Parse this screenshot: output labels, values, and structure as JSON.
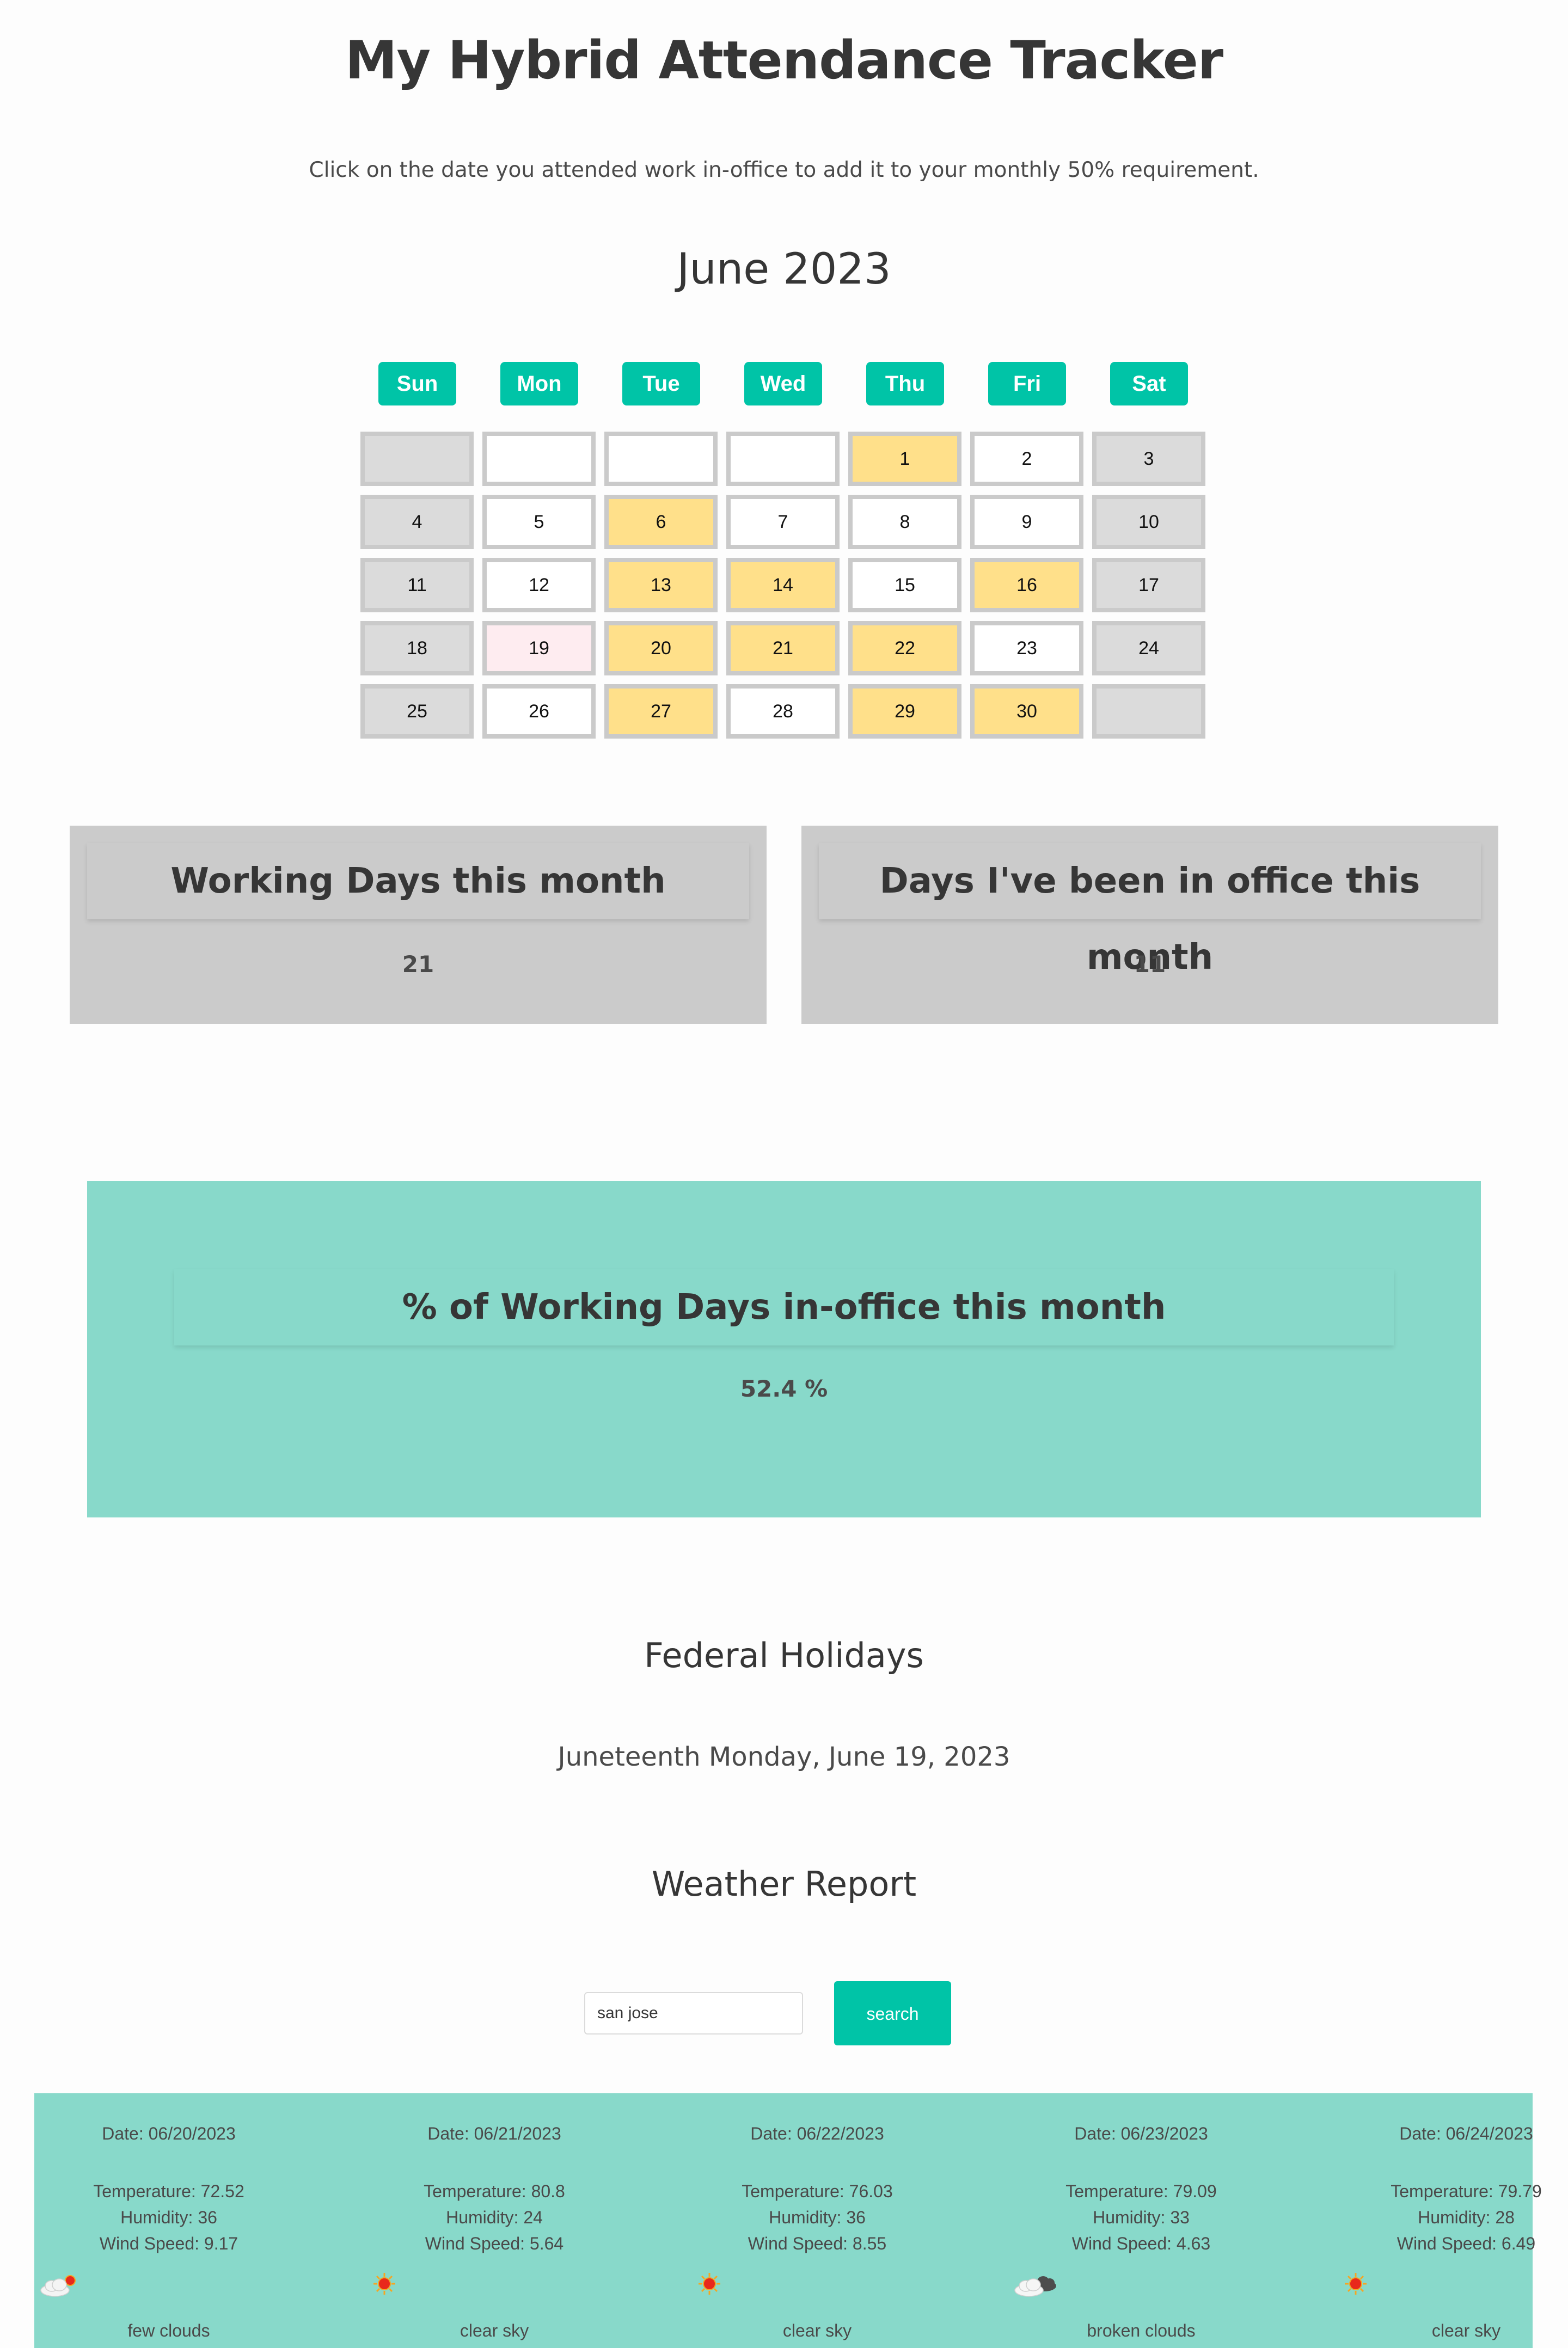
{
  "header": {
    "title": "My Hybrid Attendance Tracker",
    "subtitle": "Click on the date you attended work in-office to add it to your monthly 50% requirement."
  },
  "calendar": {
    "month_label": "June 2023",
    "weekdays": [
      "Sun",
      "Mon",
      "Tue",
      "Wed",
      "Thu",
      "Fri",
      "Sat"
    ],
    "rows": [
      [
        {
          "d": "",
          "s": "weekend"
        },
        {
          "d": "",
          "s": "empty"
        },
        {
          "d": "",
          "s": "empty"
        },
        {
          "d": "",
          "s": "empty"
        },
        {
          "d": "1",
          "s": "attended"
        },
        {
          "d": "2",
          "s": "workday"
        },
        {
          "d": "3",
          "s": "weekend"
        }
      ],
      [
        {
          "d": "4",
          "s": "weekend"
        },
        {
          "d": "5",
          "s": "workday"
        },
        {
          "d": "6",
          "s": "attended"
        },
        {
          "d": "7",
          "s": "workday"
        },
        {
          "d": "8",
          "s": "workday"
        },
        {
          "d": "9",
          "s": "workday"
        },
        {
          "d": "10",
          "s": "weekend"
        }
      ],
      [
        {
          "d": "11",
          "s": "weekend"
        },
        {
          "d": "12",
          "s": "workday"
        },
        {
          "d": "13",
          "s": "attended"
        },
        {
          "d": "14",
          "s": "attended"
        },
        {
          "d": "15",
          "s": "workday"
        },
        {
          "d": "16",
          "s": "attended"
        },
        {
          "d": "17",
          "s": "weekend"
        }
      ],
      [
        {
          "d": "18",
          "s": "weekend"
        },
        {
          "d": "19",
          "s": "holiday"
        },
        {
          "d": "20",
          "s": "attended"
        },
        {
          "d": "21",
          "s": "attended"
        },
        {
          "d": "22",
          "s": "attended"
        },
        {
          "d": "23",
          "s": "workday"
        },
        {
          "d": "24",
          "s": "weekend"
        }
      ],
      [
        {
          "d": "25",
          "s": "weekend"
        },
        {
          "d": "26",
          "s": "workday"
        },
        {
          "d": "27",
          "s": "attended"
        },
        {
          "d": "28",
          "s": "workday"
        },
        {
          "d": "29",
          "s": "attended"
        },
        {
          "d": "30",
          "s": "attended"
        },
        {
          "d": "",
          "s": "weekend"
        }
      ]
    ],
    "colors": {
      "weekday_header": "#00c4a7",
      "attended": "#ffe08a",
      "weekend": "#dbdbdb",
      "holiday": "#feecf0",
      "workday": "#ffffff"
    }
  },
  "stats": {
    "working_days_label": "Working Days this month",
    "working_days_value": "21",
    "office_days_label": "Days I've been in office this month",
    "office_days_value": "11",
    "percent_label": "% of Working Days in-office this month",
    "percent_value": "52.4 %"
  },
  "holidays": {
    "title": "Federal Holidays",
    "items": [
      "Juneteenth Monday, June 19, 2023"
    ]
  },
  "weather": {
    "title": "Weather Report",
    "search_value": "san jose",
    "search_button": "search",
    "forecast": [
      {
        "date": "Date: 06/20/2023",
        "temp": "Temperature: 72.52",
        "humidity": "Humidity: 36",
        "wind": "Wind Speed: 9.17",
        "icon": "few-clouds-icon",
        "desc": "few clouds"
      },
      {
        "date": "Date: 06/21/2023",
        "temp": "Temperature: 80.8",
        "humidity": "Humidity: 24",
        "wind": "Wind Speed: 5.64",
        "icon": "clear-sky-icon",
        "desc": "clear sky"
      },
      {
        "date": "Date: 06/22/2023",
        "temp": "Temperature: 76.03",
        "humidity": "Humidity: 36",
        "wind": "Wind Speed: 8.55",
        "icon": "clear-sky-icon",
        "desc": "clear sky"
      },
      {
        "date": "Date: 06/23/2023",
        "temp": "Temperature: 79.09",
        "humidity": "Humidity: 33",
        "wind": "Wind Speed: 4.63",
        "icon": "broken-clouds-icon",
        "desc": "broken clouds"
      },
      {
        "date": "Date: 06/24/2023",
        "temp": "Temperature: 79.79",
        "humidity": "Humidity: 28",
        "wind": "Wind Speed: 6.49",
        "icon": "clear-sky-icon",
        "desc": "clear sky"
      }
    ]
  }
}
